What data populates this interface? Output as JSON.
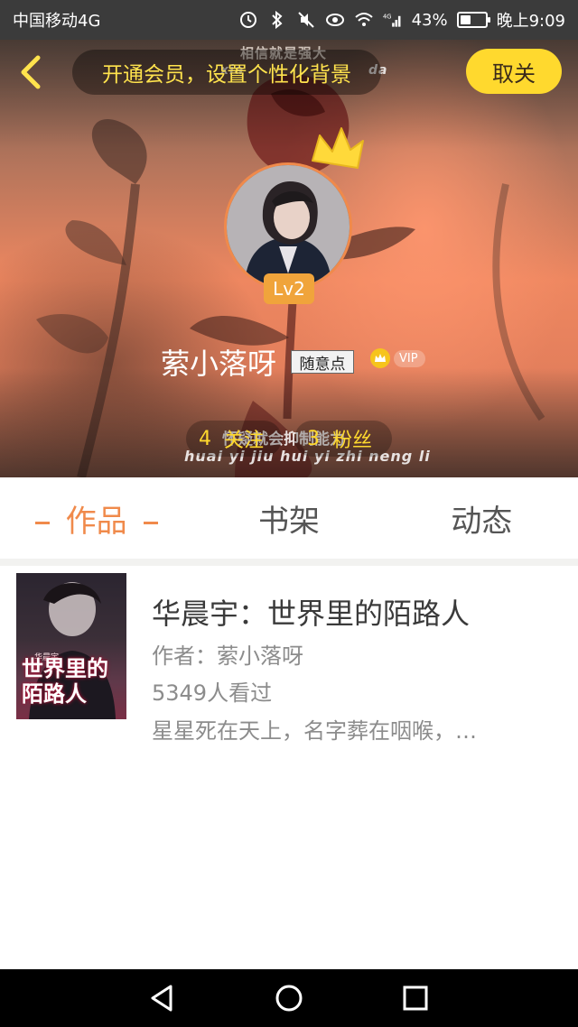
{
  "status_bar": {
    "carrier": "中国移动4G",
    "battery_pct": "43%",
    "battery_level": 0.43,
    "time": "晚上9:09",
    "network": "4G"
  },
  "header": {
    "promo_text": "开通会员，设置个性化背景",
    "cancel_label": "取关",
    "lyric_top": "相信就是强大",
    "lyric_top_pinyin_left": "xia",
    "lyric_top_pinyin_right": "da"
  },
  "profile": {
    "level": "Lv2",
    "username": "萦小落呀",
    "tag": "随意点",
    "vip_label": "VIP",
    "lyric": "怀疑就会抑制能力",
    "lyric_pinyin": "huai yi jiu hui yi zhi neng li",
    "following_count": "4",
    "following_label": "关注",
    "fans_count": "3",
    "fans_label": "粉丝"
  },
  "tabs": [
    {
      "label": "作品",
      "active": true
    },
    {
      "label": "书架",
      "active": false
    },
    {
      "label": "动态",
      "active": false
    }
  ],
  "works": [
    {
      "title": "华晨宇：世界里的陌路人",
      "author": "作者：萦小落呀",
      "views": "5349人看过",
      "description": "星星死在天上，名字葬在咽喉，…",
      "cover_title": "世界里的陌路人",
      "cover_subtitle": "华晨宇"
    }
  ],
  "colors": {
    "accent": "#f08a4b",
    "promo_text": "#ffe34d",
    "cancel_bg": "#ffd92e",
    "follow_text": "#ffd92e",
    "level_badge": "#f0a43b"
  },
  "icons": {
    "back": "chevron-left-icon",
    "crown": "crown-icon",
    "vip": "vip-crown-icon",
    "nav_back": "triangle-back-icon",
    "nav_home": "circle-home-icon",
    "nav_recent": "square-recent-icon"
  }
}
